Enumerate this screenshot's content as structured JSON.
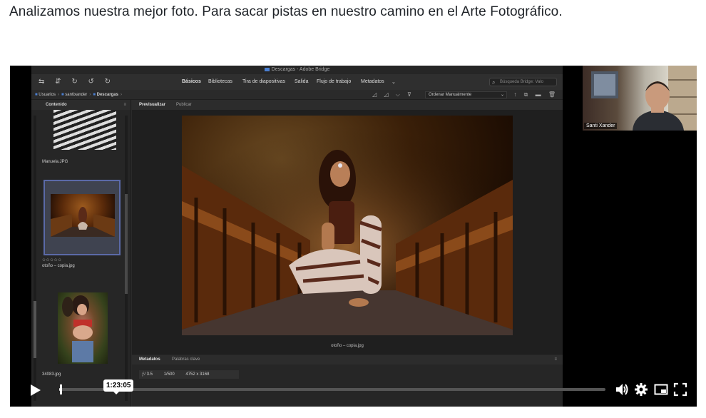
{
  "page": {
    "heading": "Analizamos nuestra mejor foto. Para sacar pistas en nuestro camino en el Arte Fotográfico."
  },
  "bridge": {
    "window_title": "Descargas - Adobe Bridge",
    "workspaces": [
      "Básicos",
      "Bibliotecas",
      "Tira de diapositivas",
      "Salida",
      "Flujo de trabajo",
      "Metadatos"
    ],
    "search_placeholder": "Búsqueda Bridge: Valo",
    "path": [
      "Usuarios",
      "santixander",
      "Descargas"
    ],
    "sort_label": "Ordenar Manualmente",
    "content_panel_title": "Contenido",
    "thumbnails": [
      {
        "label": "Manuela.JPG"
      },
      {
        "label": "otoño – copia.jpg",
        "stars": "✩✩✩✩✩"
      },
      {
        "label": "34083.jpg"
      }
    ],
    "preview_tabs": [
      "Previsualizar",
      "Publicar"
    ],
    "preview_caption": "otoño – copia.jpg",
    "metadata_tabs": [
      "Metadatos",
      "Palabras clave"
    ],
    "exif": {
      "aperture": "ƒ/ 3.5",
      "shutter": "1/500",
      "dimensions": "4752 x 3168"
    }
  },
  "webcam": {
    "name": "Santi Xander"
  },
  "player": {
    "time_tooltip": "1:23:05",
    "progress_fraction": 0.003
  }
}
